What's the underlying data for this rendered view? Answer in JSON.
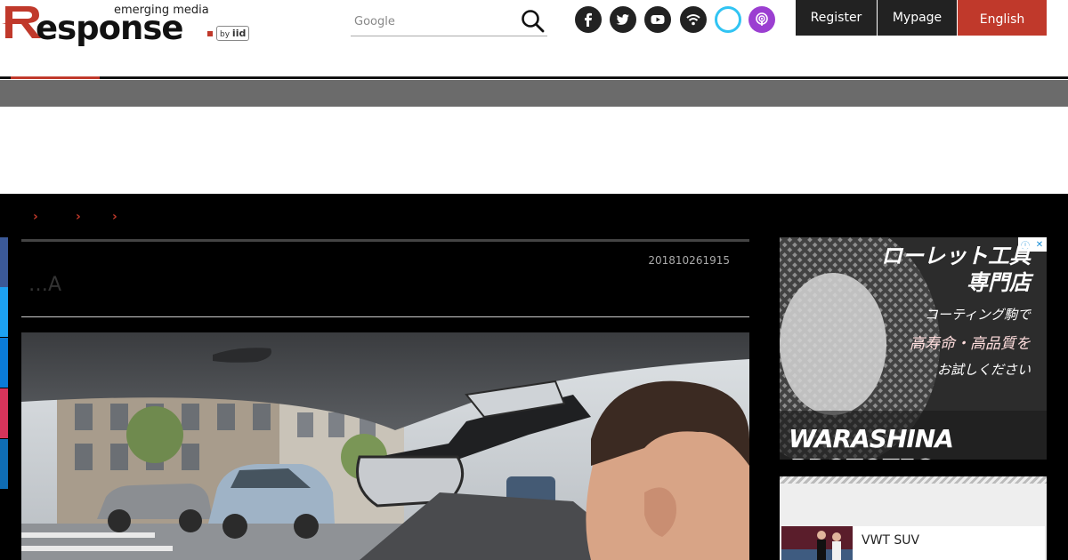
{
  "header": {
    "tagline": "emerging media",
    "logo_text": "esponse",
    "logo_by": "by",
    "logo_iid": "iid",
    "search_placeholder": "Google",
    "social": [
      "facebook-icon",
      "twitter-icon",
      "youtube-icon",
      "rss-icon",
      "alexa-icon",
      "podcast-icon"
    ],
    "buttons": {
      "register": "Register",
      "mypage": "Mypage",
      "english": "English"
    },
    "colors": {
      "accent_red": "#c0392b",
      "button_dark": "#222222",
      "alexa_blue": "#31c4f3",
      "podcast_purple": "#9b3fd1"
    }
  },
  "breadcrumb": {
    "separators": [
      "›",
      "›",
      "›"
    ]
  },
  "article": {
    "date": "201810261915",
    "title": "…A"
  },
  "ad": {
    "title_line1": "ローレット工具",
    "title_line2": "専門店",
    "line1": "コーティング駒で",
    "line2": "高寿命・高品質を",
    "line3": "お試しください",
    "brand": "WARASHINA PROTOTEC",
    "close_info": "ⓘ",
    "close_x": "✕"
  },
  "ranking": {
    "items": [
      {
        "label": "VWT SUV"
      }
    ]
  }
}
